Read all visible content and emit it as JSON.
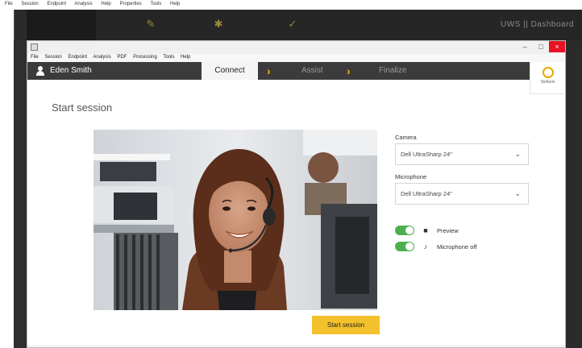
{
  "outer_menu": [
    "File",
    "Session",
    "Endpoint",
    "Analysis",
    "Help",
    "Properties",
    "Tools",
    "Help"
  ],
  "back_toolbar": {
    "right_status": "UWS || Dashboard"
  },
  "window": {
    "menu": [
      "File",
      "Session",
      "Endpoint",
      "Analysis",
      "PDF",
      "Processing",
      "Tools",
      "Help"
    ],
    "controls": {
      "minimize": "–",
      "maximize": "□",
      "close": "×"
    }
  },
  "navbar": {
    "user_name": "Eden Smith",
    "steps": [
      {
        "label": "Connect"
      },
      {
        "label": "Assist"
      },
      {
        "label": "Finalize"
      }
    ]
  },
  "logo": {
    "text": "Stellarie"
  },
  "page": {
    "title": "Start session",
    "camera_label": "Camera",
    "camera_value": "Dell UltraSharp 24\"",
    "microphone_label": "Microphone",
    "microphone_value": "Dell UltraSharp 24\"",
    "preview_label": "Preview",
    "preview_on": true,
    "mic_toggle_label": "Microphone off",
    "mic_toggle_on": true,
    "start_button": "Start session"
  },
  "colors": {
    "accent": "#f3c12c",
    "toggle": "#4caf50",
    "navbar": "#3b3b3b"
  }
}
